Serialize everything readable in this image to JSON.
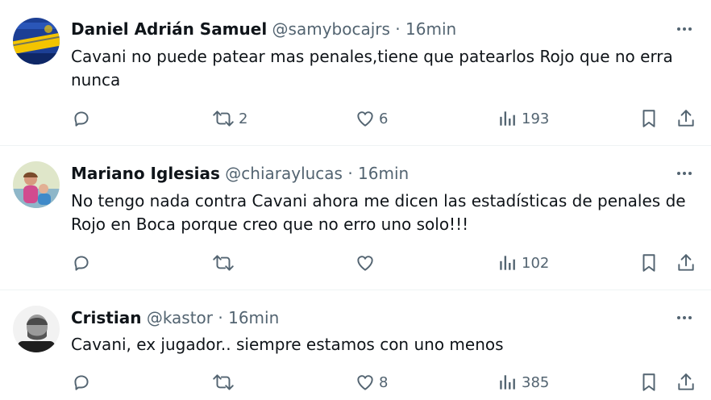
{
  "replies": [
    {
      "name": "Daniel Adrián Samuel",
      "handle": "@samybocajrs",
      "separator": "·",
      "time": "16min",
      "text_lines": [
        "Cavani no puede patear mas penales,tiene que patearlos Rojo que no erra",
        "nunca"
      ],
      "replies_count": "",
      "retweets_count": "2",
      "likes_count": "6",
      "views_count": "193",
      "avatar": "boca-jrs-scarf-avatar"
    },
    {
      "name": "Mariano Iglesias",
      "handle": "@chiaraylucas",
      "separator": "·",
      "time": "16min",
      "text_lines": [
        "No tengo nada contra Cavani ahora me dicen las estadísticas de penales de",
        "Rojo en Boca porque creo que no erro uno solo!!!"
      ],
      "replies_count": "",
      "retweets_count": "",
      "likes_count": "",
      "views_count": "102",
      "avatar": "children-photo-avatar"
    },
    {
      "name": "Cristian",
      "handle": "@kastor",
      "separator": "·",
      "time": "16min",
      "text_lines": [
        "Cavani, ex jugador.. siempre estamos con uno menos"
      ],
      "replies_count": "",
      "retweets_count": "",
      "likes_count": "8",
      "views_count": "385",
      "avatar": "bw-portrait-avatar"
    }
  ],
  "colors": {
    "text": "#0f1419",
    "secondary": "#536471",
    "divider": "#eff3f4",
    "boca_blue": "#1c3f94",
    "boca_yellow": "#f3c400"
  },
  "icons": [
    "reply-icon",
    "retweet-icon",
    "like-icon",
    "views-icon",
    "bookmark-icon",
    "share-icon",
    "more-icon"
  ]
}
